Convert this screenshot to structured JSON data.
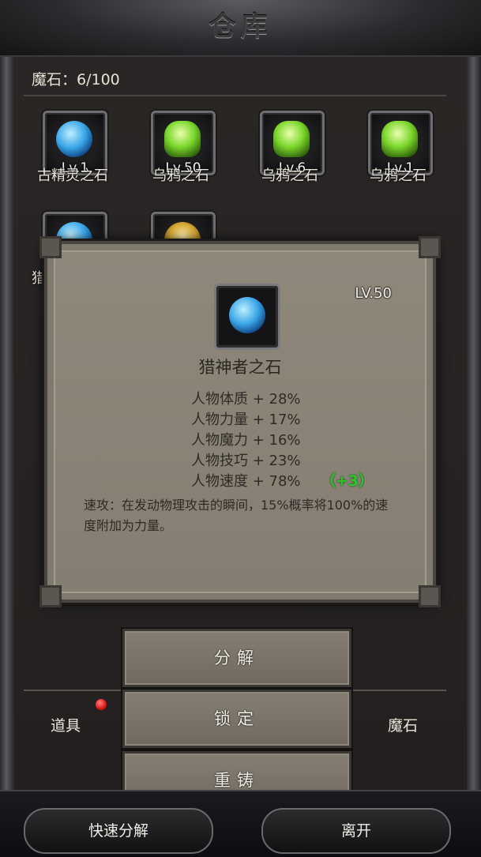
{
  "window": {
    "title": "仓库"
  },
  "header": {
    "stone_count": "魔石：6/100"
  },
  "inventory": {
    "items": [
      {
        "level": "Lv.1",
        "name": "古精灵之石",
        "icon": "blue-orb-stone-icon"
      },
      {
        "level": "Lv.50",
        "name": "乌鸦之石",
        "icon": "green-crystal-stone-icon"
      },
      {
        "level": "Lv.6",
        "name": "乌鸦之石",
        "icon": "green-crystal-stone-icon"
      },
      {
        "level": "Lv.1",
        "name": "乌鸦之石",
        "icon": "green-crystal-stone-icon"
      },
      {
        "level": "",
        "name": "猎",
        "icon": "blue-swirl-stone-icon"
      },
      {
        "level": "",
        "name": "",
        "icon": "gold-crest-stone-icon"
      }
    ]
  },
  "popup": {
    "level": "LV.50",
    "name": "猎神者之石",
    "icon": "blue-swirl-stone-icon",
    "stats": [
      "人物体质 + 28%",
      "人物力量 + 17%",
      "人物魔力 + 16%",
      "人物技巧 + 23%",
      "人物速度 + 78%"
    ],
    "bonus": "（+3）",
    "description": "速攻：在发动物理攻击的瞬间，15%概率将100%的速度附加为力量。"
  },
  "actions": {
    "decompose": "分解",
    "lock": "锁定",
    "recast": "重铸"
  },
  "tabs": {
    "items": "道具",
    "stones": "魔石"
  },
  "bottom": {
    "quick_decompose": "快速分解",
    "leave": "离开"
  },
  "colors": {
    "bonus_green": "#27c827",
    "badge_red": "#e01515",
    "popup_bg": "#8e877a"
  }
}
